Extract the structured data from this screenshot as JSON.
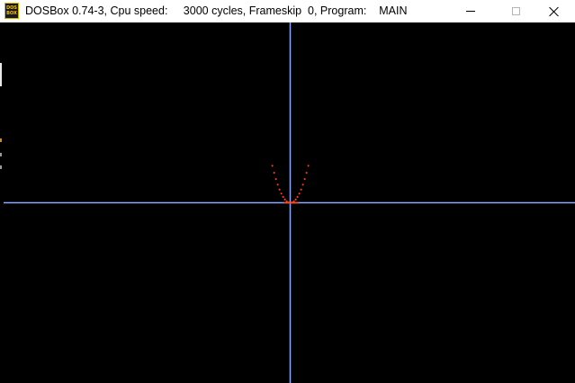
{
  "window": {
    "title": "DOSBox 0.74-3, Cpu speed:     3000 cycles, Frameskip  0, Program:    MAIN",
    "icon_name": "dosbox-icon",
    "icon_text_top": "DOS",
    "icon_text_bottom": "BOX",
    "controls": [
      "minimize",
      "maximize",
      "close"
    ]
  },
  "colors": {
    "background": "#000000",
    "axis": "#8ea6ff",
    "curve": "#ff4a1c",
    "titlebar": "#ffffff"
  }
}
